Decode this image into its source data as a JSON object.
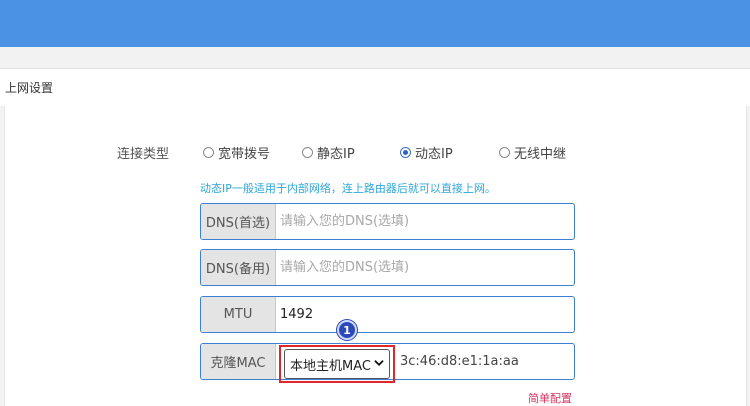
{
  "header": {
    "color": "#4b92e5"
  },
  "section": {
    "title": "上网设置"
  },
  "connection": {
    "label": "连接类型",
    "options": [
      {
        "label": "宽带拨号",
        "checked": false
      },
      {
        "label": "静态IP",
        "checked": false
      },
      {
        "label": "动态IP",
        "checked": true
      },
      {
        "label": "无线中继",
        "checked": false
      }
    ],
    "hint": "动态IP一般适用于内部网络，连上路由器后就可以直接上网。"
  },
  "fields": {
    "dns_primary": {
      "label": "DNS(首选)",
      "placeholder": "请输入您的DNS(选填)",
      "value": ""
    },
    "dns_backup": {
      "label": "DNS(备用)",
      "placeholder": "请输入您的DNS(选填)",
      "value": ""
    },
    "mtu": {
      "label": "MTU",
      "value": "1492"
    },
    "mac": {
      "label": "克隆MAC",
      "selected": "本地主机MAC",
      "value": "3c:46:d8:e1:1a:aa"
    }
  },
  "annotation": {
    "badge": "1",
    "highlight_color": "#e0282b"
  },
  "footer": {
    "link": "简单配置"
  }
}
